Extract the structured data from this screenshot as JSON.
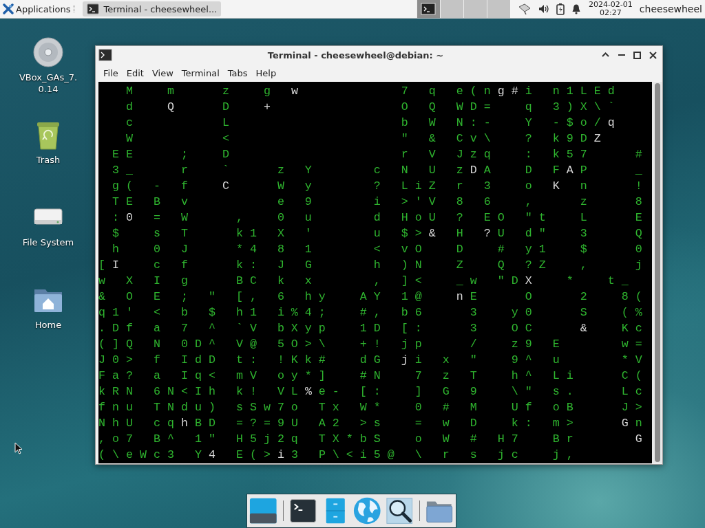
{
  "panel": {
    "menu_label": "Applications",
    "tasks": [
      {
        "title": "Terminal - cheesewheel...",
        "selected": true
      }
    ],
    "workspaces": [
      {
        "selected": true
      },
      {
        "selected": false
      },
      {
        "selected": false
      },
      {
        "selected": false
      }
    ],
    "clock": {
      "date": "2024-02-01",
      "time": "02:27"
    },
    "user": "cheesewheel"
  },
  "desktop_icons": [
    {
      "label": "VBox_GAs_7.0.14",
      "kind": "disc"
    },
    {
      "label": "Trash",
      "kind": "trash"
    },
    {
      "label": "File System",
      "kind": "drive"
    },
    {
      "label": "Home",
      "kind": "home"
    }
  ],
  "window": {
    "title": "Terminal - cheesewheel@debian: ~",
    "menu": [
      "File",
      "Edit",
      "View",
      "Terminal",
      "Tabs",
      "Help"
    ],
    "terminal": {
      "rows": [
        {
          "segments": [
            {
              "text": "    M     m       z     g   ",
              "head": false
            },
            {
              "text": "w",
              "head": true
            },
            {
              "text": "               7   q   e ( n ",
              "head": false
            },
            {
              "text": "g #",
              "head": true
            },
            {
              "text": " i   n 1 L E d",
              "head": false
            }
          ]
        },
        {
          "segments": [
            {
              "text": "    d     ",
              "head": false
            },
            {
              "text": "Q",
              "head": true
            },
            {
              "text": "       D     ",
              "head": false
            },
            {
              "text": "+",
              "head": true
            },
            {
              "text": "                   O   Q   W D =     q   3 ) X \\ `",
              "head": false
            }
          ]
        },
        {
          "segments": [
            {
              "text": "    c             L                         b   W   N : -     Y   - $ o / ",
              "head": false
            },
            {
              "text": "q",
              "head": true
            }
          ]
        },
        {
          "segments": [
            {
              "text": "    W             <                         \"   &   C v \\     ?   k 9 D ",
              "head": false
            },
            {
              "text": "Z",
              "head": true
            }
          ]
        },
        {
          "segments": [
            {
              "text": "  E E       ;     D                         r   V   J z q     :   k 5 7       #",
              "head": false
            }
          ]
        },
        {
          "segments": [
            {
              "text": "  3 _       r     `       z   Y         c   N   U   z ",
              "head": false
            },
            {
              "text": "D",
              "head": true
            },
            {
              "text": " A     D   F ",
              "head": false
            },
            {
              "text": "A",
              "head": true
            },
            {
              "text": " P       _",
              "head": false
            }
          ]
        },
        {
          "segments": [
            {
              "text": "  g (   -   f     ",
              "head": false
            },
            {
              "text": "C",
              "head": true
            },
            {
              "text": "       W   y         ?   L i Z   r   3     o   ",
              "head": false
            },
            {
              "text": "K",
              "head": true
            },
            {
              "text": "   n       !",
              "head": false
            }
          ]
        },
        {
          "segments": [
            {
              "text": "  T E   B   v             e   9         i   > ' V   8   6     ,       z       8",
              "head": false
            }
          ]
        },
        {
          "segments": [
            {
              "text": "  : ",
              "head": false
            },
            {
              "text": "0",
              "head": true
            },
            {
              "text": "   =   W       ,     0   u         d   H o U   ?   E O   \" t     L       E",
              "head": false
            }
          ]
        },
        {
          "segments": [
            {
              "text": "  $     s   T       k 1   X   '         u   $ > ",
              "head": false
            },
            {
              "text": "&",
              "head": true
            },
            {
              "text": "   H   ",
              "head": false
            },
            {
              "text": "?",
              "head": true
            },
            {
              "text": " U   d \"     3       Q",
              "head": false
            }
          ]
        },
        {
          "segments": [
            {
              "text": "  h     0   J       * 4   8   1         <   v O     D     #   y 1     $       0",
              "head": false
            }
          ]
        },
        {
          "segments": [
            {
              "text": "[ ",
              "head": false
            },
            {
              "text": "I",
              "head": true
            },
            {
              "text": "     c   f       k :   J   G         h   ) N     Z     Q   ? Z     ,       j",
              "head": false
            }
          ]
        },
        {
          "segments": [
            {
              "text": "w   X   I   g       B C   k   x         ,   ] <     _ w   \" D ",
              "head": false
            },
            {
              "text": "X",
              "head": true
            },
            {
              "text": "     *     t _",
              "head": false
            }
          ]
        },
        {
          "segments": [
            {
              "text": "&   O   E   ;   \"   [ ,   6   h y     A Y   1 @     ",
              "head": false
            },
            {
              "text": "n",
              "head": true
            },
            {
              "text": " E       O       2     8 (",
              "head": false
            }
          ]
        },
        {
          "segments": [
            {
              "text": "q 1 '   <   b   $   h 1   i % 4 ;     # ,   b 6       3     y 0       S     ( %",
              "head": false
            }
          ]
        },
        {
          "segments": [
            {
              "text": ". D f   a   7   ^   ` V   b X y p     1 D   [ :       3     O C       ",
              "head": false
            },
            {
              "text": "&",
              "head": true
            },
            {
              "text": "     K c",
              "head": false
            }
          ]
        },
        {
          "segments": [
            {
              "text": "( ] Q   N   0 D ^   V @   5 O > \\     + !   j p       /     z 9   E         w =",
              "head": false
            }
          ]
        },
        {
          "segments": [
            {
              "text": "J 0 >   f   I d D   t :   ! K k #     d G   ",
              "head": false
            },
            {
              "text": "j",
              "head": true
            },
            {
              "text": " i   x   \"     9 ^   u         * V",
              "head": false
            }
          ]
        },
        {
          "segments": [
            {
              "text": "F a ?   a   I q <   m V   o y * ]     # N     7   z   T     h ^   L i       C (",
              "head": false
            }
          ]
        },
        {
          "segments": [
            {
              "text": "k R N   6 N < I h   k !   V L ",
              "head": false
            },
            {
              "text": "%",
              "head": true
            },
            {
              "text": " e -   [ :     ]   G   9     \\ \"   s .       L c",
              "head": false
            }
          ]
        },
        {
          "segments": [
            {
              "text": "f n u   T N d u )   s S w 7 o   T x   W *     0   #   M     U f   o B       J >",
              "head": false
            }
          ]
        },
        {
          "segments": [
            {
              "text": "N h U   c q ",
              "head": false
            },
            {
              "text": "h",
              "head": true
            },
            {
              "text": " B D   = ? = 9 U   A 2   > s     =   w   D     k :   m >       ",
              "head": false
            },
            {
              "text": "G",
              "head": true
            },
            {
              "text": " n",
              "head": false
            }
          ]
        },
        {
          "segments": [
            {
              "text": ", o 7   B ^   1 \"   H 5 j 2 q   T X * b S     o   W   #   H 7     B r         ",
              "head": false
            },
            {
              "text": "G",
              "head": true
            }
          ]
        },
        {
          "segments": [
            {
              "text": "( \\ e W c 3   Y ",
              "head": false
            },
            {
              "text": "4",
              "head": true
            },
            {
              "text": "   E ( > ",
              "head": false
            },
            {
              "text": "i",
              "head": true
            },
            {
              "text": " 3   P \\ < i 5 @   \\   r   s   j c     j ,",
              "head": false
            }
          ]
        }
      ]
    }
  },
  "dock": {
    "items": [
      {
        "kind": "desktop"
      },
      {
        "kind": "separator"
      },
      {
        "kind": "terminal"
      },
      {
        "kind": "cabinet"
      },
      {
        "kind": "globe"
      },
      {
        "kind": "search"
      },
      {
        "kind": "separator"
      },
      {
        "kind": "folder"
      }
    ]
  }
}
